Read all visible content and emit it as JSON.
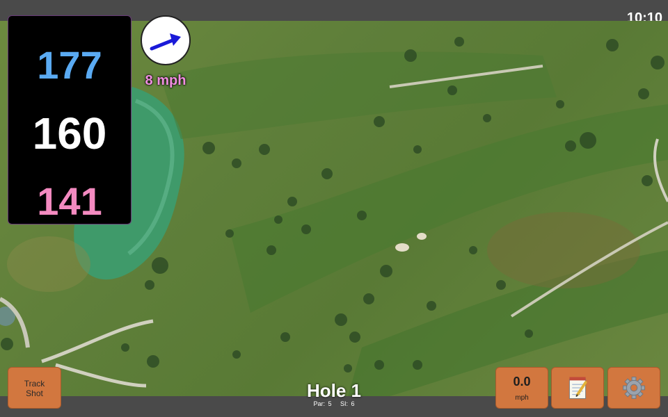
{
  "status_bar": {
    "time": "10:10"
  },
  "distances": {
    "back": "177",
    "middle": "160",
    "front": "141",
    "colors": {
      "back": "#5aaaf2",
      "middle": "#ffffff",
      "front": "#f38ac0"
    }
  },
  "wind": {
    "speed_label": "8 mph",
    "direction_icon": "arrow-icon"
  },
  "buttons": {
    "track_shot": "Track\nShot",
    "speed_value": "0.0",
    "speed_unit": "mph",
    "notes_icon": "notepad-icon",
    "settings_icon": "gear-icon"
  },
  "hole": {
    "title": "Hole 1",
    "par": "Par: 5",
    "si": "SI: 6"
  },
  "colors": {
    "button": "#d2773f",
    "map_green": "#5f7f3a",
    "panel": "#000000"
  }
}
